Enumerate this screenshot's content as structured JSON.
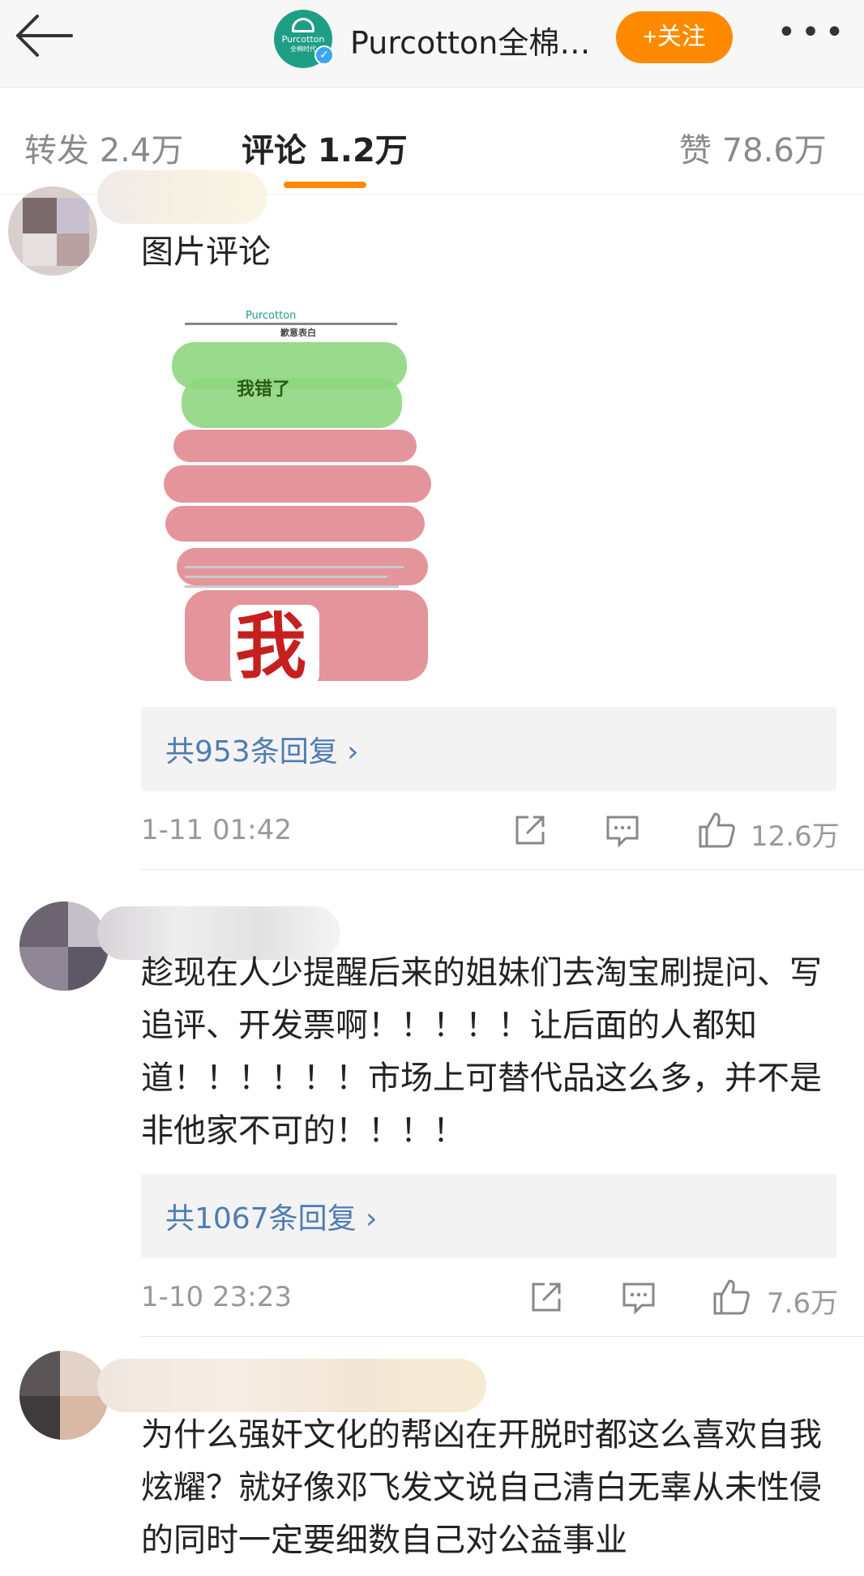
{
  "header": {
    "back_icon": "back-arrow-icon",
    "logo_brand": "Purcotton",
    "logo_sub": "全棉时代",
    "title": "Purcotton全棉…",
    "follow_label": "+关注",
    "more_icon": "more-dots-icon"
  },
  "tabs": [
    {
      "label": "转发 2.4万",
      "active": false
    },
    {
      "label": "评论 1.2万",
      "active": true
    },
    {
      "label": "赞 78.6万",
      "active": false
    }
  ],
  "accent_color": "#ff8a00",
  "comments": [
    {
      "label": "图片评论",
      "image": {
        "brand": "Purcotton",
        "heading": "歉意表白",
        "sticker_text_1": "我错了",
        "sticker_text_2": "我"
      },
      "reply_link": "共953条回复 ›",
      "time": "1-11 01:42",
      "likes": "12.6万"
    },
    {
      "text": "趁现在人少提醒后来的姐妹们去淘宝刷提问、写追评、开发票啊！！！！！让后面的人都知道！！！！！！市场上可替代品这么多，并不是非他家不可的！！！！",
      "reply_link": "共1067条回复 ›",
      "time": "1-10 23:23",
      "likes": "7.6万"
    },
    {
      "text": "为什么强奸文化的帮凶在开脱时都这么喜欢自我炫耀？就好像邓飞发文说自己清白无辜从未性侵的同时一定要细数自己对公益事业"
    }
  ]
}
